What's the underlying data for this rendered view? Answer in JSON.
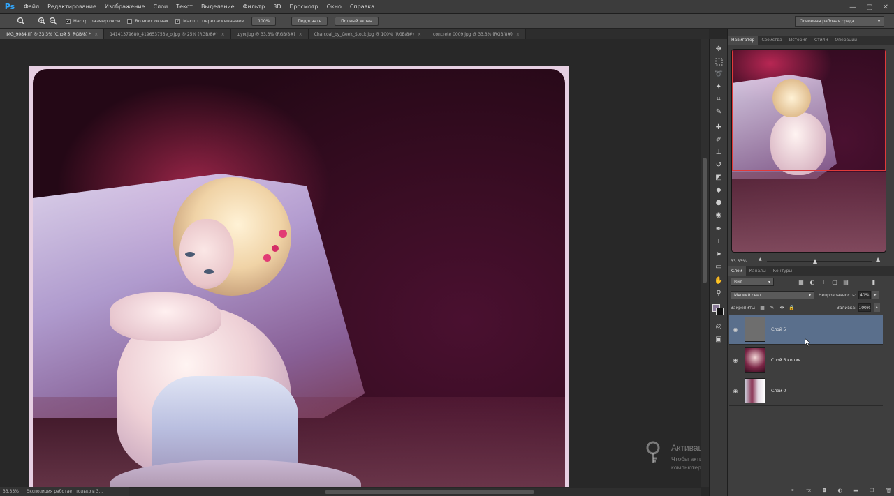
{
  "app": {
    "logo": "Ps",
    "menu": [
      "Файл",
      "Редактирование",
      "Изображение",
      "Слои",
      "Текст",
      "Выделение",
      "Фильтр",
      "3D",
      "Просмотр",
      "Окно",
      "Справка"
    ],
    "window_controls": [
      "—",
      "▢",
      "✕"
    ]
  },
  "options": {
    "check1": "Настр. размер окон",
    "check2": "Во всех окнах",
    "check3": "Масшт. перетаскиванием",
    "btn_100": "100%",
    "btn_fit": "Подогнать",
    "btn_full": "Полный экран",
    "workspace": "Основная рабочая среда"
  },
  "tabs": [
    {
      "label": "IMG_9084.tif @ 33,3% (Слой 5, RGB/8) *",
      "close": "×"
    },
    {
      "label": "14141379680_419653753e_o.jpg @ 25% (RGB/8#)",
      "close": "×"
    },
    {
      "label": "шум.jpg @ 33,3% (RGB/8#)",
      "close": "×"
    },
    {
      "label": "Charcoal_by_Geek_Stock.jpg @ 100% (RGB/8#)",
      "close": "×"
    },
    {
      "label": "concrete 0009.jpg @ 33,3% (RGB/8#)",
      "close": "×"
    }
  ],
  "status": {
    "zoom": "33.33%",
    "text": "Экспозиция работает только в 3..."
  },
  "watermark": {
    "title": "Активация Windows",
    "text": "Чтобы активировать Windows, перейдите к параметрам компьютера."
  },
  "panels": {
    "top_tabs": [
      "Навигатор",
      "Свойства",
      "История",
      "Стили",
      "Операции"
    ],
    "nav_zoom": "33.33%",
    "layer_tabs": [
      "Слои",
      "Каналы",
      "Контуры"
    ],
    "filter_kind": "Вид",
    "blend_mode": "Мягкий свет",
    "opacity_label": "Непрозрачность:",
    "opacity_value": "40%",
    "lock_label": "Закрепить:",
    "fill_label": "Заливка:",
    "fill_value": "100%"
  },
  "layers": [
    {
      "name": "Слой 5",
      "selected": true,
      "visible": true
    },
    {
      "name": "Слой 6 копия",
      "selected": false,
      "visible": true
    },
    {
      "name": "Слой 0",
      "selected": false,
      "visible": true
    }
  ],
  "colors": {
    "foreground": "#8a7a98",
    "background": "#111111",
    "selection": "#5a6f8c"
  }
}
